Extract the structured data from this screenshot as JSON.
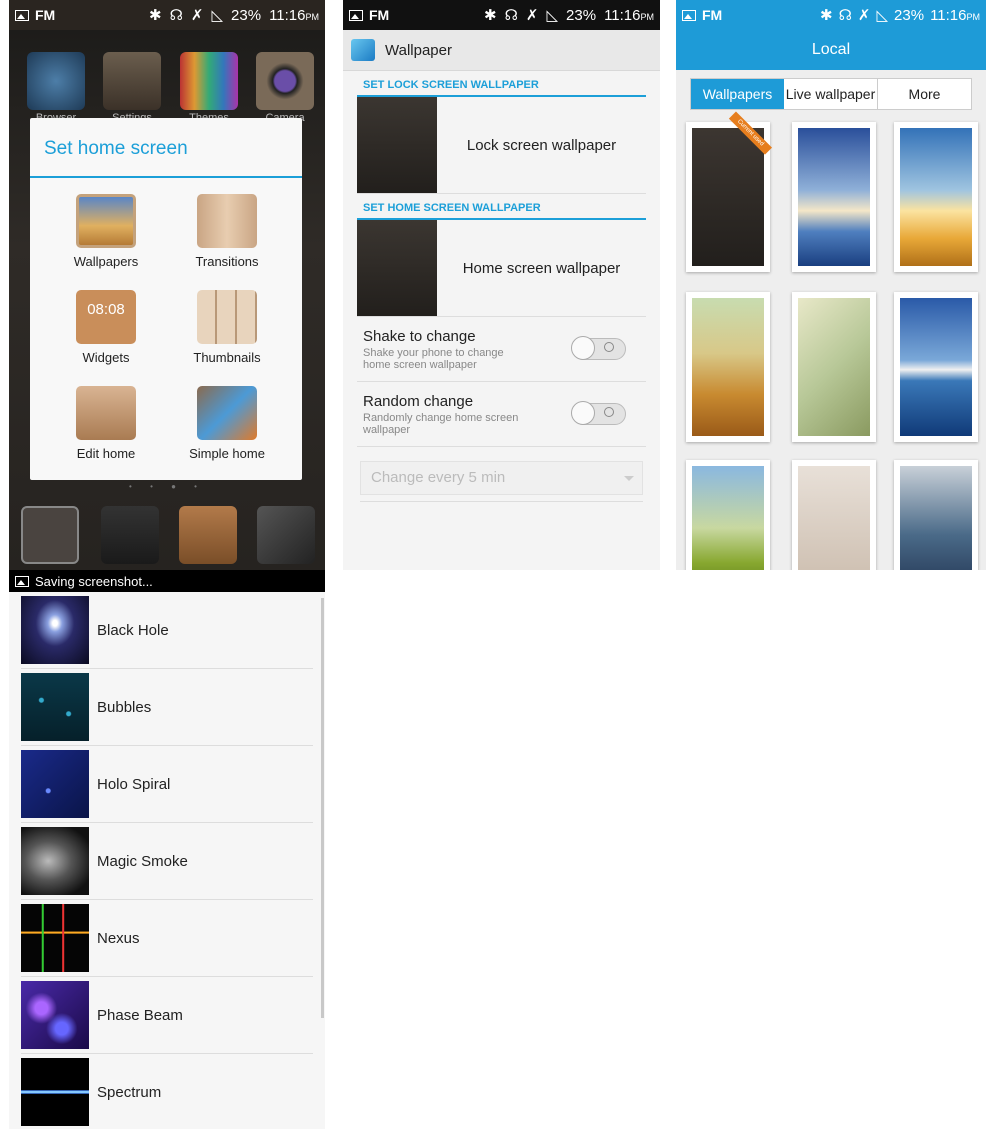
{
  "status_bar": {
    "carrier": "FM",
    "battery": "23%",
    "time": "11:16",
    "ampm": "PM"
  },
  "panel1": {
    "apps_top": [
      "Browser",
      "Settings",
      "Themes",
      "Camera"
    ],
    "dialog_title": "Set home screen",
    "items": [
      {
        "label": "Wallpapers",
        "icon": "wallpapers-icon"
      },
      {
        "label": "Transitions",
        "icon": "transitions-icon"
      },
      {
        "label": "Widgets",
        "icon": "widgets-icon",
        "clock": "08:08"
      },
      {
        "label": "Thumbnails",
        "icon": "thumbnails-icon"
      },
      {
        "label": "Edit home",
        "icon": "edit-home-icon"
      },
      {
        "label": "Simple home",
        "icon": "simple-home-icon"
      }
    ],
    "dock": [
      "phone-icon",
      "contacts-icon",
      "messaging-icon",
      "play-store-icon"
    ]
  },
  "panel2": {
    "title": "Wallpaper",
    "lock_section": "SET LOCK SCREEN WALLPAPER",
    "lock_label": "Lock screen wallpaper",
    "home_section": "SET HOME SCREEN WALLPAPER",
    "home_label": "Home screen wallpaper",
    "shake_title": "Shake to change",
    "shake_desc": "Shake your phone to change home screen wallpaper",
    "random_title": "Random change",
    "random_desc": "Randomly change home screen wallpaper",
    "interval": "Change every 5 min"
  },
  "panel3": {
    "title": "Local",
    "tabs": [
      "Wallpapers",
      "Live wallpaper",
      "More"
    ],
    "ribbon": "Current used"
  },
  "panel4": {
    "status": "Saving screenshot...",
    "items": [
      "Black Hole",
      "Bubbles",
      "Holo Spiral",
      "Magic Smoke",
      "Nexus",
      "Phase Beam",
      "Spectrum"
    ]
  }
}
